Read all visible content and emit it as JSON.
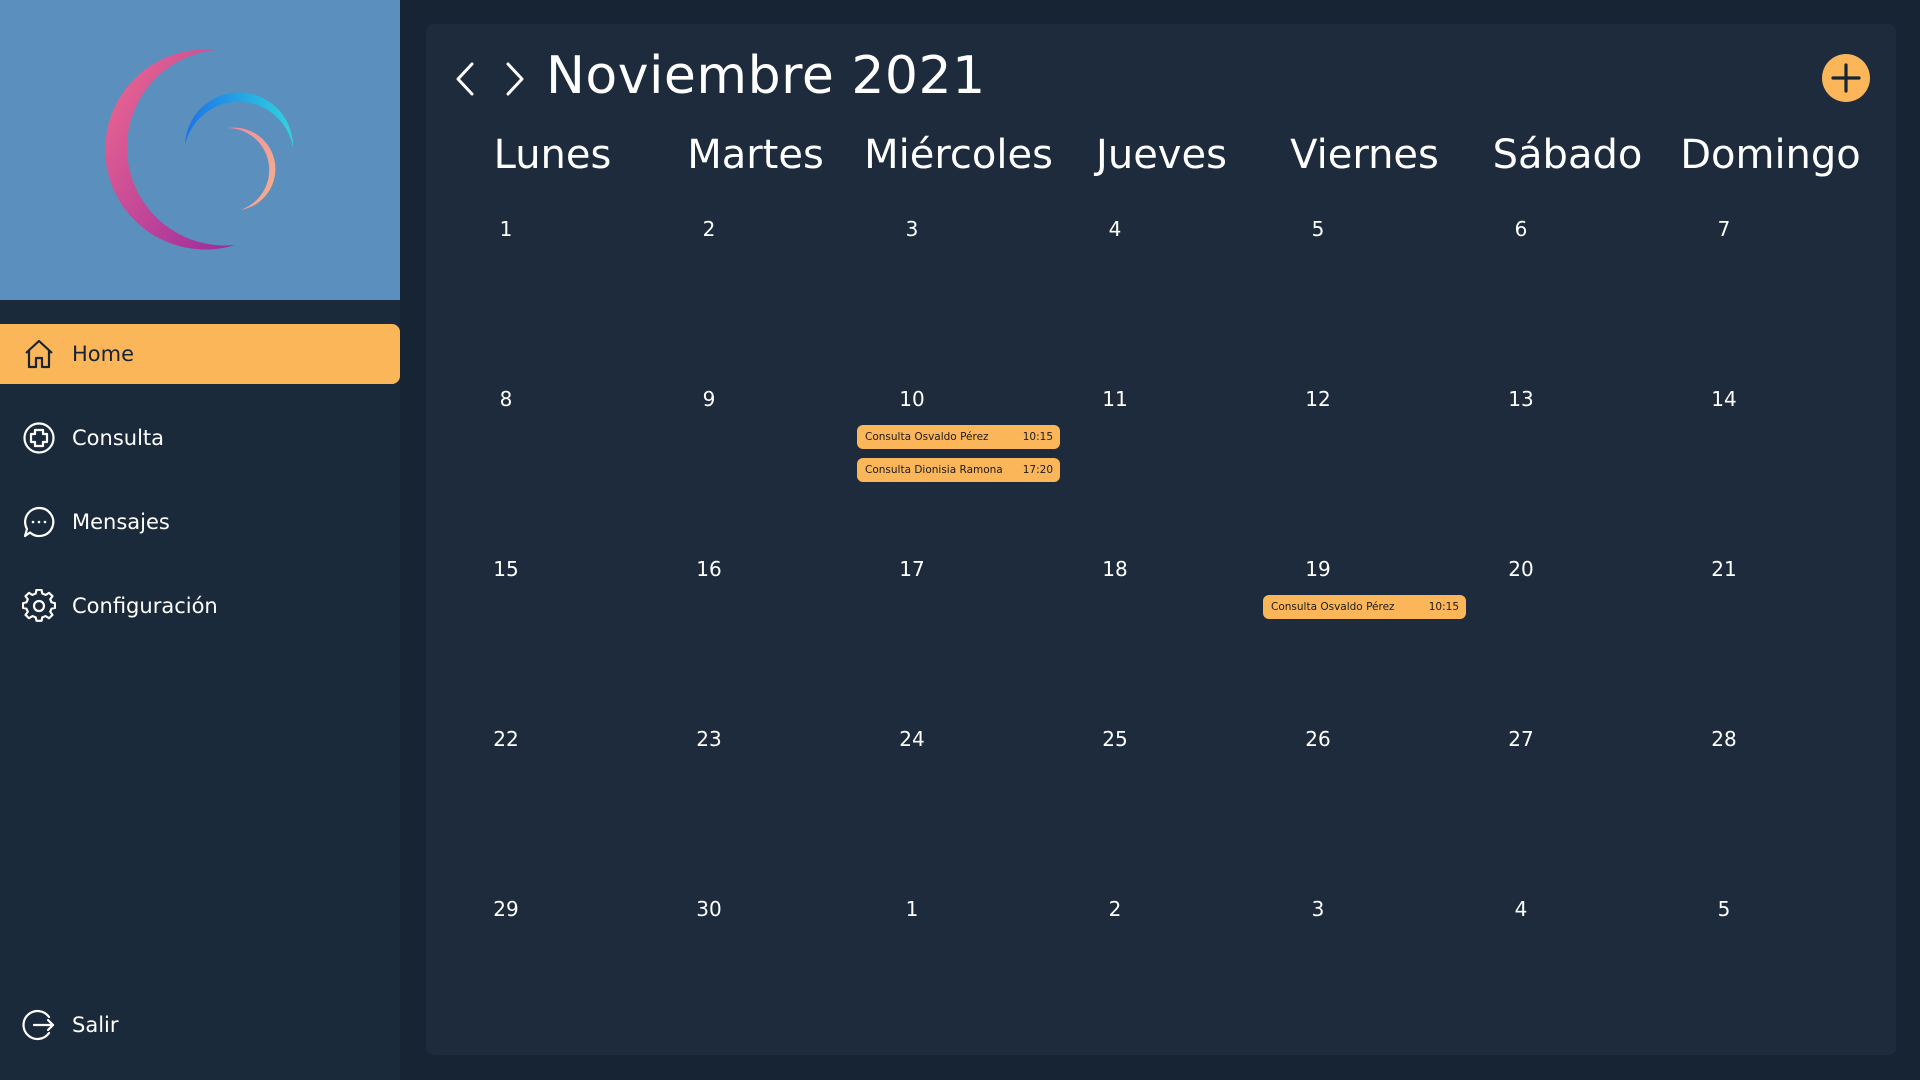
{
  "colors": {
    "accent": "#fbb65a",
    "background": "#172433",
    "panel": "#1d2b3c",
    "logo_panel": "#5b8fbd"
  },
  "sidebar": {
    "items": [
      {
        "label": "Home",
        "icon": "home-icon",
        "active": true
      },
      {
        "label": "Consulta",
        "icon": "plus-circle-icon",
        "active": false
      },
      {
        "label": "Mensajes",
        "icon": "chat-bubble-icon",
        "active": false
      },
      {
        "label": "Configuración",
        "icon": "gear-icon",
        "active": false
      }
    ],
    "logout": {
      "label": "Salir",
      "icon": "logout-icon"
    }
  },
  "calendar": {
    "month_title": "Noviembre 2021",
    "weekdays": [
      "Lunes",
      "Martes",
      "Miércoles",
      "Jueves",
      "Viernes",
      "Sábado",
      "Domingo"
    ],
    "weeks": [
      [
        {
          "day": "1",
          "events": []
        },
        {
          "day": "2",
          "events": []
        },
        {
          "day": "3",
          "events": []
        },
        {
          "day": "4",
          "events": []
        },
        {
          "day": "5",
          "events": []
        },
        {
          "day": "6",
          "events": []
        },
        {
          "day": "7",
          "events": []
        }
      ],
      [
        {
          "day": "8",
          "events": []
        },
        {
          "day": "9",
          "events": []
        },
        {
          "day": "10",
          "events": [
            {
              "title": "Consulta Osvaldo Pérez",
              "time": "10:15"
            },
            {
              "title": "Consulta Dionisia Ramona",
              "time": "17:20"
            }
          ]
        },
        {
          "day": "11",
          "events": []
        },
        {
          "day": "12",
          "events": []
        },
        {
          "day": "13",
          "events": []
        },
        {
          "day": "14",
          "events": []
        }
      ],
      [
        {
          "day": "15",
          "events": []
        },
        {
          "day": "16",
          "events": []
        },
        {
          "day": "17",
          "events": []
        },
        {
          "day": "18",
          "events": []
        },
        {
          "day": "19",
          "events": [
            {
              "title": "Consulta Osvaldo Pérez",
              "time": "10:15"
            }
          ]
        },
        {
          "day": "20",
          "events": []
        },
        {
          "day": "21",
          "events": []
        }
      ],
      [
        {
          "day": "22",
          "events": []
        },
        {
          "day": "23",
          "events": []
        },
        {
          "day": "24",
          "events": []
        },
        {
          "day": "25",
          "events": []
        },
        {
          "day": "26",
          "events": []
        },
        {
          "day": "27",
          "events": []
        },
        {
          "day": "28",
          "events": []
        }
      ],
      [
        {
          "day": "29",
          "events": []
        },
        {
          "day": "30",
          "events": []
        },
        {
          "day": "1",
          "events": []
        },
        {
          "day": "2",
          "events": []
        },
        {
          "day": "3",
          "events": []
        },
        {
          "day": "4",
          "events": []
        },
        {
          "day": "5",
          "events": []
        }
      ]
    ]
  }
}
